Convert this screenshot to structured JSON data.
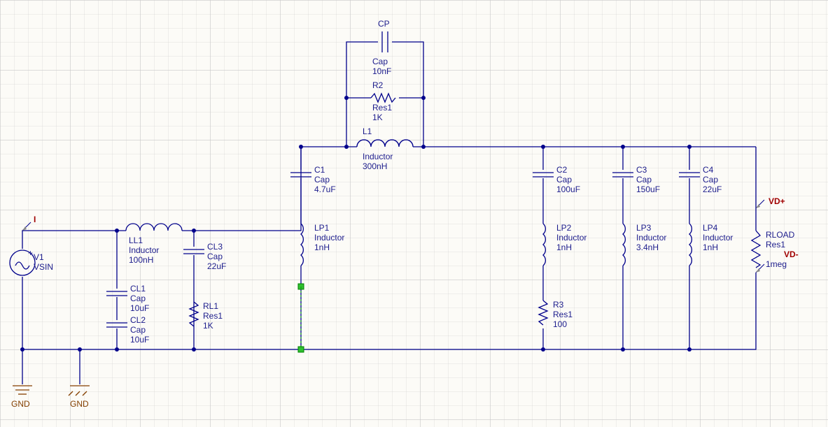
{
  "components": {
    "V1": {
      "ref": "V1",
      "type": "VSIN",
      "value": ""
    },
    "LL1": {
      "ref": "LL1",
      "type": "Inductor",
      "value": "100nH"
    },
    "CL1": {
      "ref": "CL1",
      "type": "Cap",
      "value": "10uF"
    },
    "CL2": {
      "ref": "CL2",
      "type": "Cap",
      "value": "10uF"
    },
    "CL3": {
      "ref": "CL3",
      "type": "Cap",
      "value": "22uF"
    },
    "RL1": {
      "ref": "RL1",
      "type": "Res1",
      "value": "1K"
    },
    "C1": {
      "ref": "C1",
      "type": "Cap",
      "value": "4.7uF"
    },
    "LP1": {
      "ref": "LP1",
      "type": "Inductor",
      "value": "1nH"
    },
    "L1": {
      "ref": "L1",
      "type": "Inductor",
      "value": "300nH"
    },
    "R2": {
      "ref": "R2",
      "type": "Res1",
      "value": "1K"
    },
    "CP": {
      "ref": "CP",
      "type": "Cap",
      "value": "10nF"
    },
    "C2": {
      "ref": "C2",
      "type": "Cap",
      "value": "100uF"
    },
    "LP2": {
      "ref": "LP2",
      "type": "Inductor",
      "value": "1nH"
    },
    "R3": {
      "ref": "R3",
      "type": "Res1",
      "value": "100"
    },
    "C3": {
      "ref": "C3",
      "type": "Cap",
      "value": "150uF"
    },
    "LP3": {
      "ref": "LP3",
      "type": "Inductor",
      "value": "3.4nH"
    },
    "C4": {
      "ref": "C4",
      "type": "Cap",
      "value": "22uF"
    },
    "LP4": {
      "ref": "LP4",
      "type": "Inductor",
      "value": "1nH"
    },
    "RLOAD": {
      "ref": "RLOAD",
      "type": "Res1",
      "value": "1meg"
    }
  },
  "nets": {
    "I": "I",
    "VDp": "VD+",
    "VDn": "VD-"
  },
  "power": {
    "GND1": "GND",
    "GND2": "GND"
  }
}
